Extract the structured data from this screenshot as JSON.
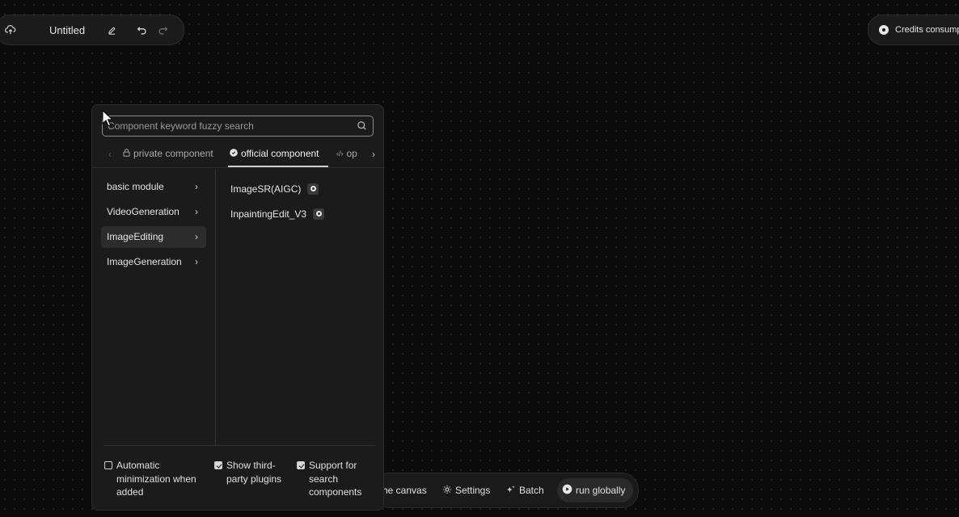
{
  "topbar": {
    "title": "Untitled"
  },
  "credits": {
    "label": "Credits consumpti"
  },
  "bottom_toolbar": {
    "canvas_label": "he canvas",
    "settings_label": "Settings",
    "batch_label": "Batch",
    "run_label": "run globally"
  },
  "panel": {
    "search": {
      "placeholder": "Component keyword fuzzy search",
      "value": ""
    },
    "tabs": [
      {
        "label": "private component",
        "icon": "lock-icon"
      },
      {
        "label": "official component",
        "icon": "official-badge-icon",
        "active": true
      },
      {
        "label": "op",
        "icon": "code-icon"
      }
    ],
    "categories": [
      {
        "label": "basic module"
      },
      {
        "label": "VideoGeneration"
      },
      {
        "label": "ImageEditing",
        "active": true
      },
      {
        "label": "ImageGeneration"
      }
    ],
    "components": [
      {
        "label": "ImageSR(AIGC)"
      },
      {
        "label": "InpaintingEdit_V3"
      }
    ],
    "options": [
      {
        "label": "Automatic minimization when added",
        "checked": false
      },
      {
        "label": "Show third-party plugins",
        "checked": true
      },
      {
        "label": "Support for search components",
        "checked": true
      }
    ]
  }
}
